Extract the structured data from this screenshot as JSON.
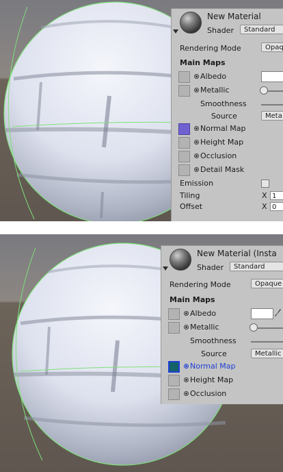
{
  "colors": {
    "viewport_bg": "#6b6258",
    "panel_bg": "#c4c4c4",
    "normal_map_slot_1": "#6f62d0",
    "normal_map_slot_2": "#14626a",
    "highlight_blue": "#1e3fd6",
    "sphere_outline": "#7fe07a"
  },
  "icons": [
    "material-sphere-icon",
    "foldout-arrow-icon",
    "texture-slot-icon",
    "object-picker-icon",
    "color-swatch",
    "eyedropper-icon",
    "slider-knob",
    "checkbox"
  ],
  "top": {
    "header": {
      "title": "New Material",
      "shader_label": "Shader",
      "shader_value": "Standard"
    },
    "rendering_mode": {
      "label": "Rendering Mode",
      "value": "Opaqu"
    },
    "main_maps_heading": "Main Maps",
    "albedo": "Albedo",
    "metallic": "Metallic",
    "smoothness": "Smoothness",
    "source": {
      "label": "Source",
      "value": "Meta"
    },
    "normal_map": "Normal Map",
    "height_map": "Height Map",
    "occlusion": "Occlusion",
    "detail_mask": "Detail Mask",
    "emission": "Emission",
    "tiling": {
      "label": "Tiling",
      "x_label": "X",
      "x_value": "1"
    },
    "offset": {
      "label": "Offset",
      "x_label": "X",
      "x_value": "0"
    }
  },
  "bottom": {
    "header": {
      "title": "New Material (Insta",
      "shader_label": "Shader",
      "shader_value": "Standard"
    },
    "rendering_mode": {
      "label": "Rendering Mode",
      "value": "Opaque"
    },
    "main_maps_heading": "Main Maps",
    "albedo": "Albedo",
    "metallic": "Metallic",
    "smoothness": "Smoothness",
    "source": {
      "label": "Source",
      "value": "Metallic"
    },
    "normal_map": "Normal Map",
    "height_map": "Height Map",
    "occlusion": "Occlusion"
  }
}
